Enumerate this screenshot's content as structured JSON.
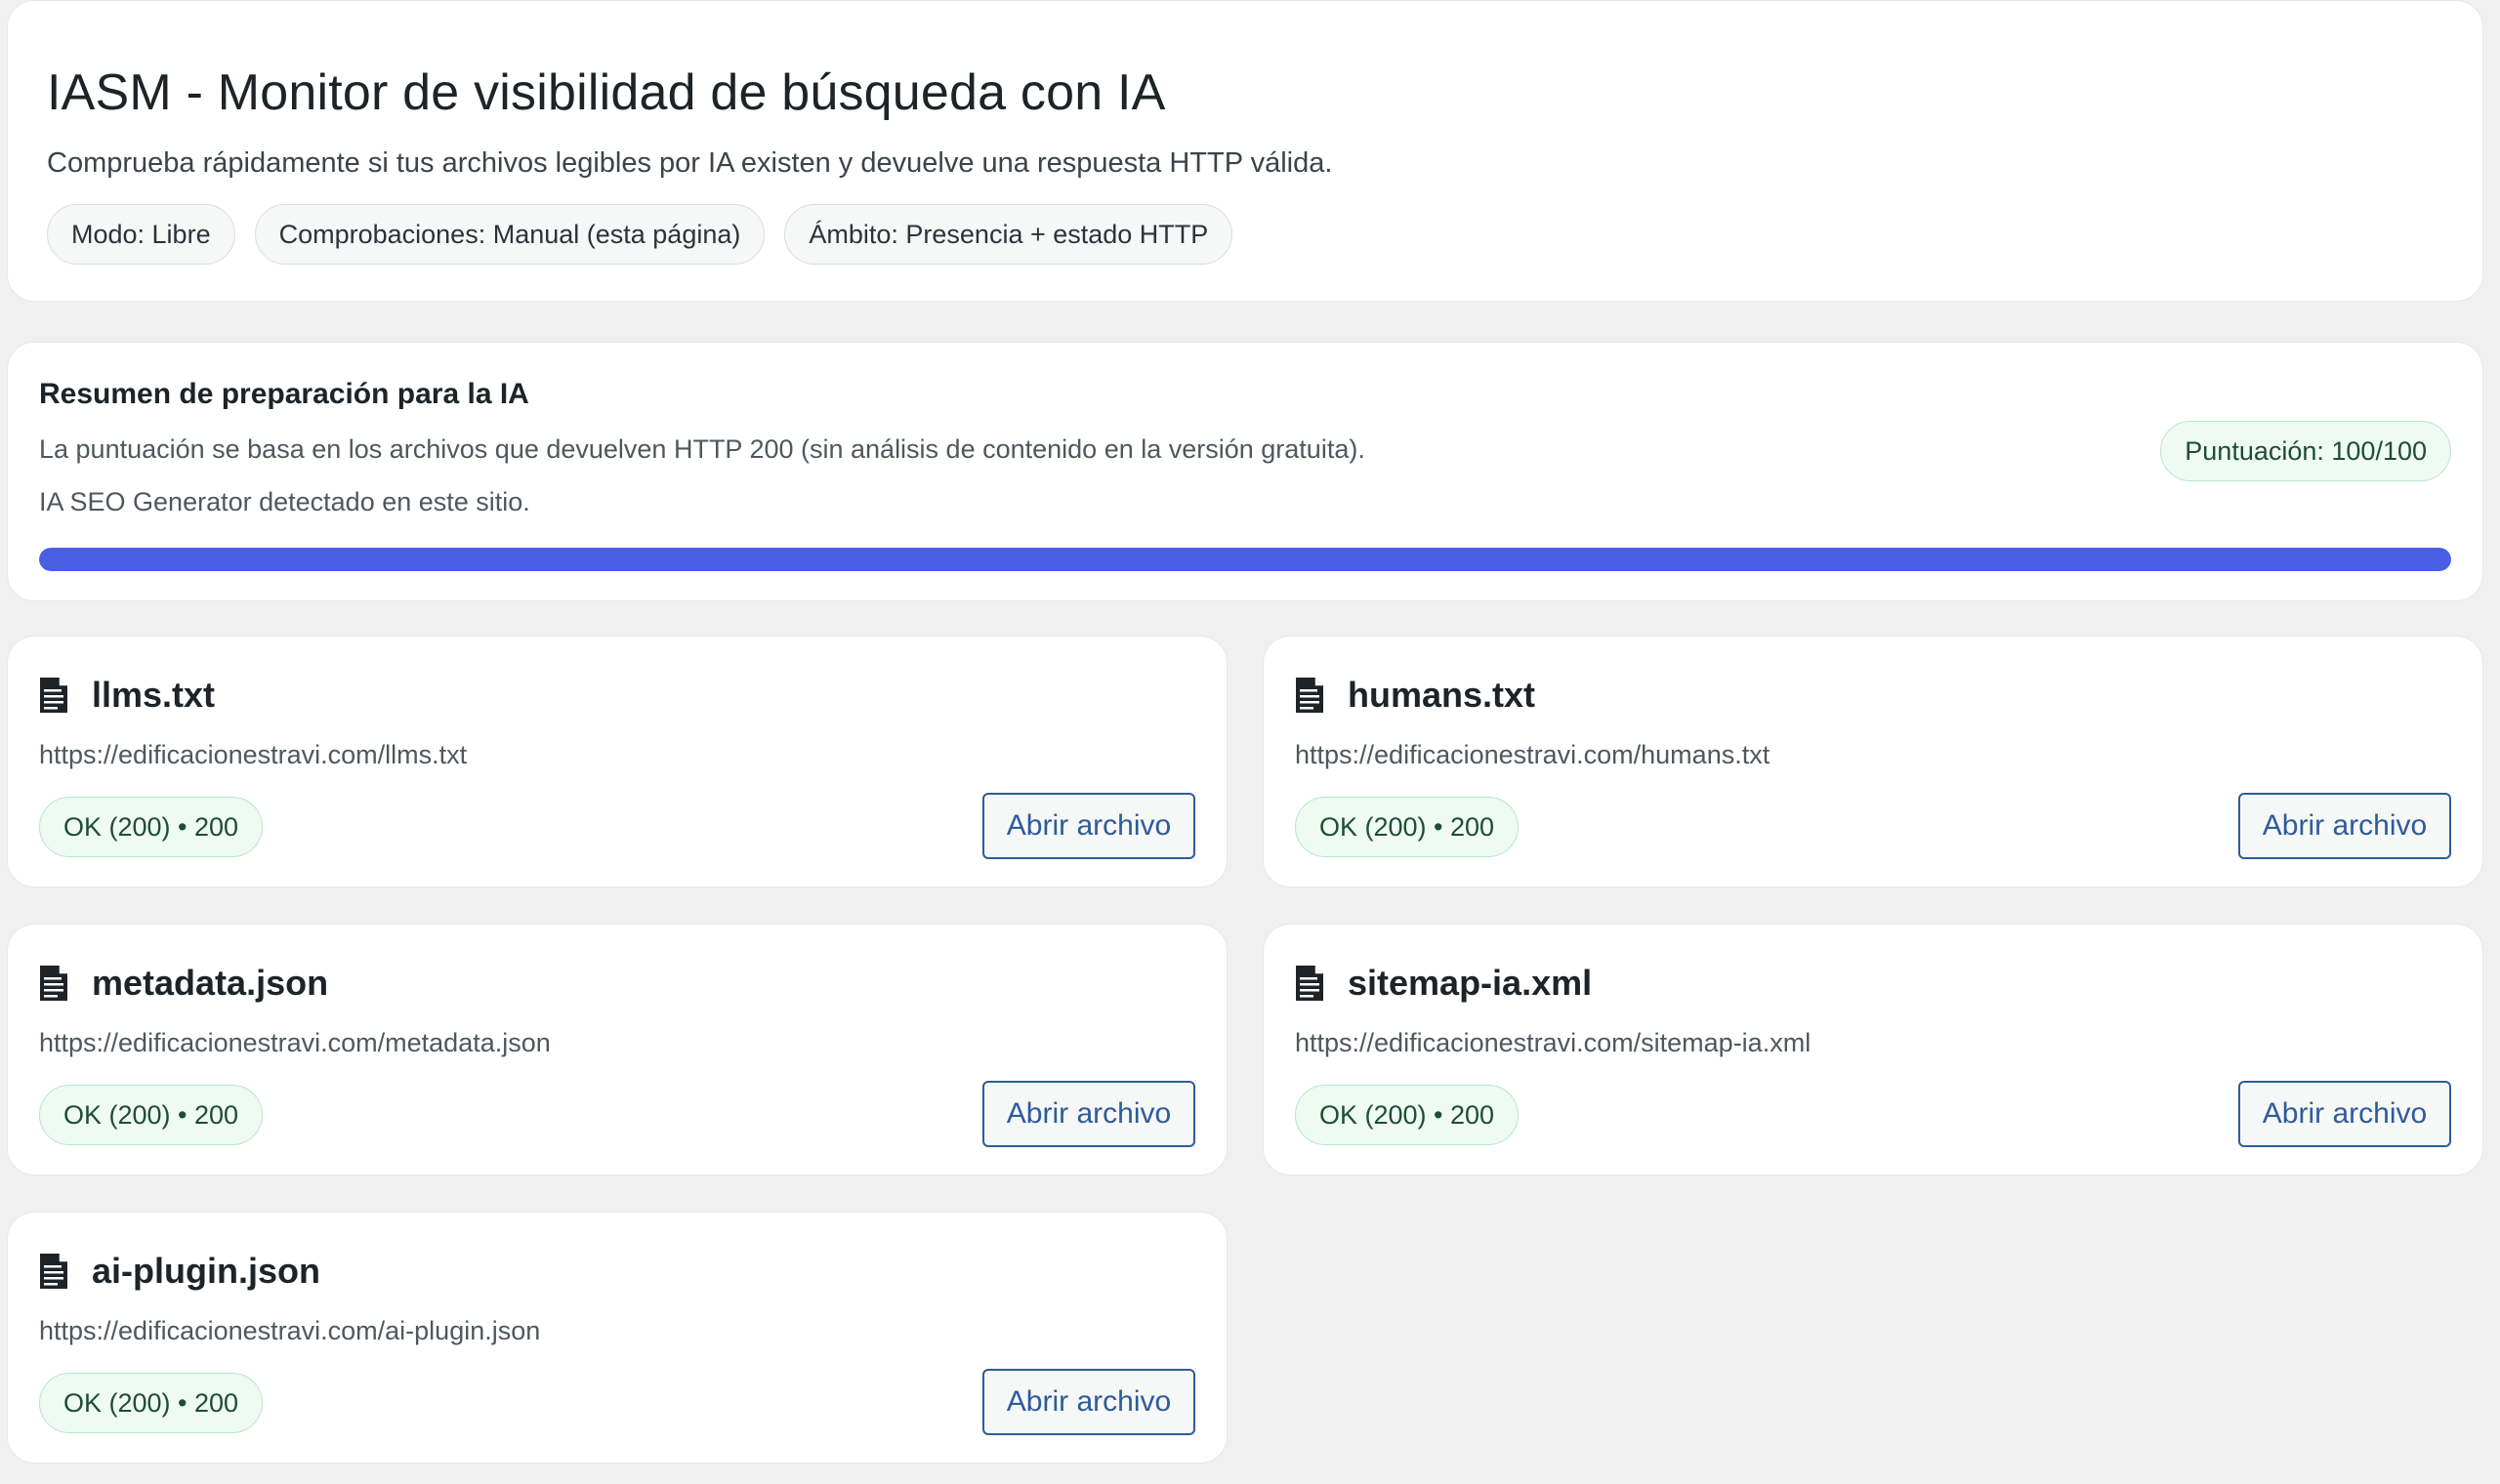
{
  "header": {
    "title": "IASM - Monitor de visibilidad de búsqueda con IA",
    "subtitle": "Comprueba rápidamente si tus archivos legibles por IA existen y devuelve una respuesta HTTP válida.",
    "pills": [
      "Modo: Libre",
      "Comprobaciones: Manual (esta página)",
      "Ámbito: Presencia + estado HTTP"
    ]
  },
  "summary": {
    "title": "Resumen de preparación para la IA",
    "description": "La puntuación se basa en los archivos que devuelven HTTP 200 (sin análisis de contenido en la versión gratuita).",
    "detected": "IA SEO Generator detectado en este sitio.",
    "score_label": "Puntuación: 100/100",
    "score_fraction": 1.0,
    "progress_color": "#4a5ee4"
  },
  "files": [
    {
      "name": "llms.txt",
      "url": "https://edificacionestravi.com/llms.txt",
      "status": "OK (200) • 200",
      "button": "Abrir archivo",
      "icon": "document-icon"
    },
    {
      "name": "humans.txt",
      "url": "https://edificacionestravi.com/humans.txt",
      "status": "OK (200) • 200",
      "button": "Abrir archivo",
      "icon": "document-icon"
    },
    {
      "name": "metadata.json",
      "url": "https://edificacionestravi.com/metadata.json",
      "status": "OK (200) • 200",
      "button": "Abrir archivo",
      "icon": "document-icon"
    },
    {
      "name": "sitemap-ia.xml",
      "url": "https://edificacionestravi.com/sitemap-ia.xml",
      "status": "OK (200) • 200",
      "button": "Abrir archivo",
      "icon": "document-icon"
    },
    {
      "name": "ai-plugin.json",
      "url": "https://edificacionestravi.com/ai-plugin.json",
      "status": "OK (200) • 200",
      "button": "Abrir archivo",
      "icon": "document-icon"
    }
  ],
  "colors": {
    "accent": "#2e5b9a",
    "success_bg": "#eefaf2",
    "success_text": "#1f4d33",
    "page_bg": "#f0f0f1"
  }
}
